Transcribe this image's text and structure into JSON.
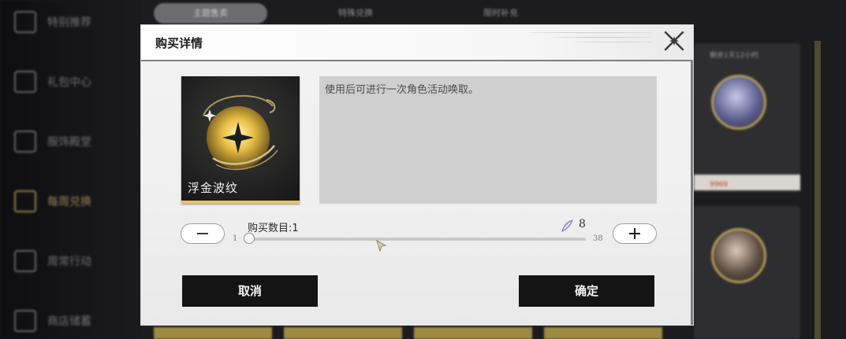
{
  "background": {
    "sidebar": [
      {
        "label": "特别推荐",
        "active": false
      },
      {
        "label": "礼包中心",
        "active": false
      },
      {
        "label": "服饰殿堂",
        "active": false
      },
      {
        "label": "每周兑换",
        "active": true
      },
      {
        "label": "周常行动",
        "active": false
      },
      {
        "label": "商店储蓄",
        "active": false
      }
    ],
    "tabs": [
      {
        "label": "主题售卖",
        "active": true
      },
      {
        "label": "特殊兑换",
        "active": false
      },
      {
        "label": "限时补充",
        "active": false
      }
    ],
    "cards": [
      {
        "timer": "剩余1天12小时",
        "tag": "9969"
      },
      {
        "timer": "",
        "tag": ""
      }
    ]
  },
  "dialog": {
    "title": "购买详情",
    "item": {
      "name": "浮金波纹",
      "description": "使用后可进行一次角色活动唤取。"
    },
    "quantity": {
      "label": "购买数目:1",
      "current": 1,
      "min": "1",
      "max": "38",
      "cost": "8"
    },
    "buttons": {
      "cancel": "取消",
      "confirm": "确定"
    }
  },
  "colors": {
    "accent_gold": "#e9c65a",
    "button_dark": "#141414",
    "panel_bg": "#f3f3f4"
  },
  "icons": {
    "close": "x-star-close-icon",
    "decrease": "minus-icon",
    "increase": "plus-icon",
    "currency": "feather-crystal-icon"
  }
}
